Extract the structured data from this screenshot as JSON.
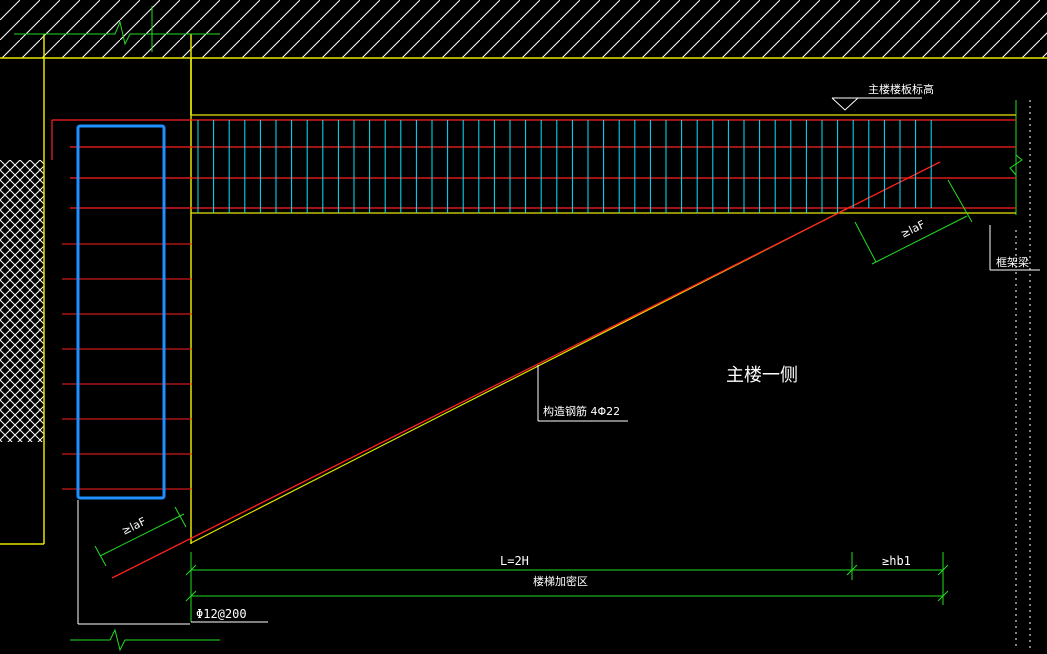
{
  "colors": {
    "background": "#000000",
    "concrete_edge": "#e6e600",
    "rebar": "#ff2020",
    "stirrup": "#00e5ff",
    "dimension": "#22dd22",
    "column_tie": "#1e90ff",
    "text": "#ffffff",
    "hatch": "#ffffff"
  },
  "labels": {
    "main_floor_level": "主楼楼板标高",
    "frame_beam": "框架梁",
    "main_building_side": "主楼一侧",
    "construction_rebar": "构造钢筋 4Φ22",
    "anchorage_right": "≥laF",
    "anchorage_left": "≥laF",
    "span_length": "L=2H",
    "min_hb1": "≥hb1",
    "stair_zone": "楼梯加密区",
    "rebar_spec": "Φ12@200"
  }
}
